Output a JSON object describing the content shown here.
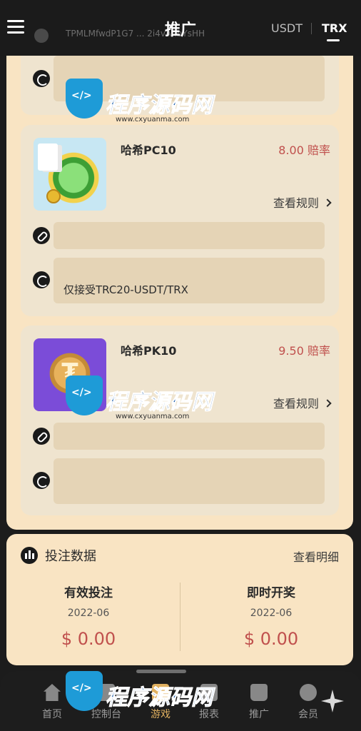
{
  "header": {
    "title": "推广",
    "currencies": [
      "USDT",
      "TRX"
    ],
    "active_currency": "TRX",
    "strip_text": "TPMLMfwdP1G7 ... 2i4vAhbYsHH"
  },
  "cards": [
    {
      "name": "哈希PC10",
      "odds": "8.00 赔率",
      "rules_label": "查看规则",
      "link_field": "",
      "wallet_field": "仅接受TRC20-USDT/TRX"
    },
    {
      "name": "哈希PK10",
      "odds": "9.50 赔率",
      "rules_label": "查看规则",
      "link_field": "",
      "wallet_field": ""
    }
  ],
  "stats": {
    "title": "投注数据",
    "detail_label": "查看明细",
    "left": {
      "label": "有效投注",
      "date": "2022-06",
      "amount": "$ 0.00"
    },
    "right": {
      "label": "即时开奖",
      "date": "2022-06",
      "amount": "$ 0.00"
    }
  },
  "nav": {
    "items": [
      {
        "label": "首页",
        "icon": "home-icon"
      },
      {
        "label": "控制台",
        "icon": "console-icon"
      },
      {
        "label": "游戏",
        "icon": "game-icon"
      },
      {
        "label": "报表",
        "icon": "chart-icon"
      },
      {
        "label": "推广",
        "icon": "bag-icon"
      },
      {
        "label": "会员",
        "icon": "person-icon"
      }
    ],
    "active_index": 2
  },
  "watermark": {
    "title": "程序源码网",
    "url": "www.cxyuanma.com"
  },
  "colors": {
    "accent": "#e0b060",
    "odds": "#c0504d",
    "panel": "#f9e4c3",
    "card": "#efe4cf",
    "field": "#e5d4b6"
  }
}
